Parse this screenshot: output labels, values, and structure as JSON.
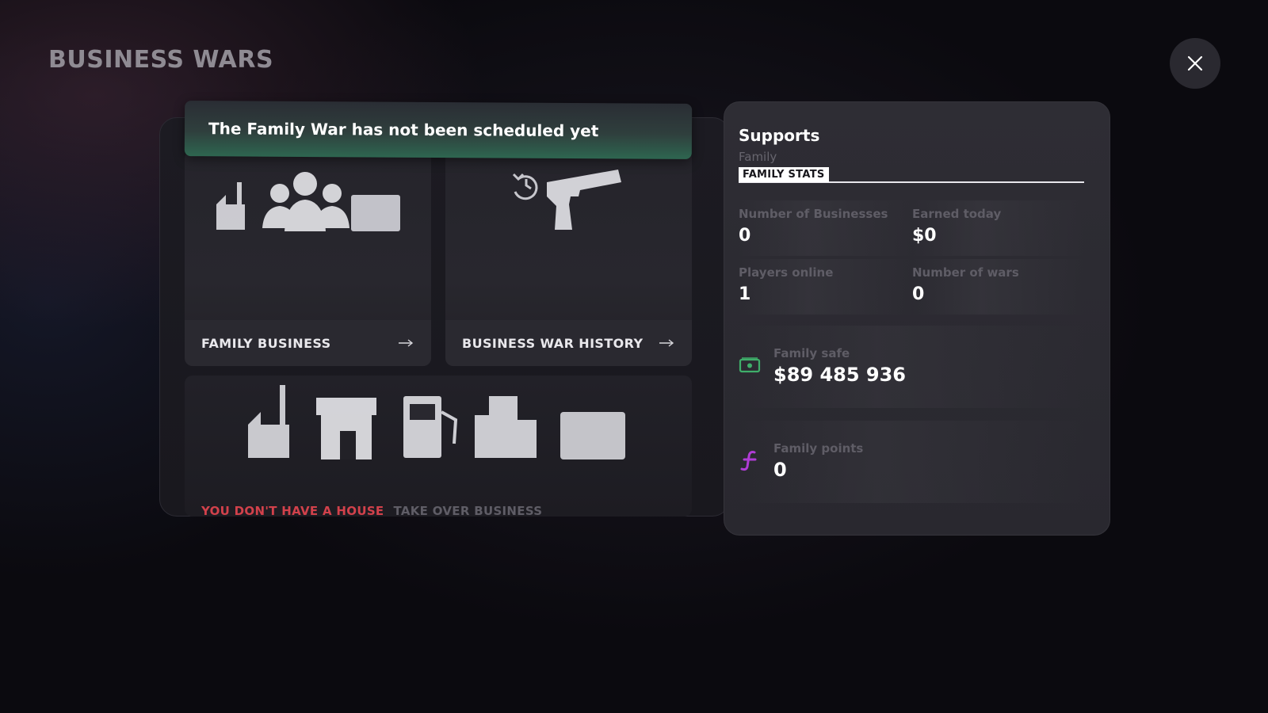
{
  "page": {
    "title": "BUSINESS WARS"
  },
  "banner": {
    "text": "The Family War has not been scheduled yet"
  },
  "cards": {
    "family_business": {
      "label": "FAMILY BUSINESS"
    },
    "war_history": {
      "label": "BUSINESS WAR HISTORY"
    },
    "business_types": {
      "no_house": "YOU DON'T HAVE A HOUSE",
      "take_over": "TAKE OVER BUSINESS"
    }
  },
  "supports": {
    "title": "Supports",
    "subtitle": "Family",
    "tab_active": "FAMILY STATS",
    "stats": [
      {
        "label": "Number of Businesses",
        "value": "0"
      },
      {
        "label": "Earned today",
        "value": "$0"
      },
      {
        "label": "Players online",
        "value": "1"
      },
      {
        "label": "Number of wars",
        "value": "0"
      }
    ],
    "family_safe": {
      "label": "Family safe",
      "value": "$89 485 936",
      "icon": "cash-icon",
      "color": "#3fae6a"
    },
    "family_points": {
      "label": "Family points",
      "value": "0",
      "icon": "family-points-icon",
      "color": "#b03cd6"
    }
  },
  "colors": {
    "accent_green": "#2e6650",
    "warning_red": "#d2414b"
  }
}
